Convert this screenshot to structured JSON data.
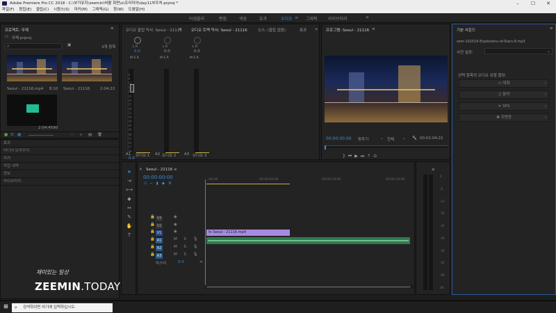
{
  "window": {
    "title": "Adobe Premiere Pro CC 2018 - C:\\부가유지\\zeemin\\비활 화면\\x\\프리미어\\day11부우처.prproj *"
  },
  "menu": [
    "파일(F)",
    "편집(E)",
    "클립(C)",
    "시퀀스(S)",
    "마커(M)",
    "그래픽(G)",
    "창(W)",
    "도움말(H)"
  ],
  "workspaces": {
    "items": [
      "어셈블리",
      "편집",
      "색상",
      "효과",
      "오디오",
      "그래픽",
      "라이브러리"
    ],
    "active": 4,
    "overflow": "»"
  },
  "project": {
    "title": "프로젝트: 무제",
    "subtitle": "무제.prproj",
    "count": "3개 항목",
    "items": [
      {
        "name": "Seoul - 21116.mp4",
        "duration": "8:10"
      },
      {
        "name": "Seoul - 21116",
        "duration": "2:04:22"
      },
      {
        "name": "",
        "duration": "2:04:4590"
      }
    ]
  },
  "left_panels": [
    "효과",
    "미디어 브라우저",
    "마커",
    "작업 내역",
    "정보",
    "라이브러리"
  ],
  "mixer": {
    "tabs": [
      "오디오 클립 믹서: Seoul - 21116",
      "오디오 트랙 믹서: Seoul - 21116",
      "소스: (클립 없음)",
      "효과"
    ],
    "channels": [
      {
        "id": "A1",
        "label": "오디오 1",
        "lr": "L  R",
        "val": "0.0"
      },
      {
        "id": "A2",
        "label": "오디오 2",
        "lr": "L  R",
        "val": "0.0"
      },
      {
        "id": "A3",
        "label": "오디오 3",
        "lr": "L  R",
        "val": "0.0"
      }
    ],
    "scale": [
      "-6",
      "-9",
      "-12",
      "-15",
      "-18",
      "-21",
      "-24",
      "-27",
      "-30",
      "-33",
      "-36",
      "-39",
      "-42",
      "-45",
      "-48",
      "-51",
      "-54",
      "-57",
      "-dB"
    ]
  },
  "program": {
    "title": "프로그램: Seoul - 21116",
    "timecode": "00:00:00:00",
    "fit": "맞추기",
    "quality": "전체",
    "duration": "00:02:04:22"
  },
  "sound": {
    "title": "기본 사운드",
    "file": "sem-102516-Explosions-of-Stars-8.mp3",
    "preset_label": "사전 설정:",
    "prompt": "선택 항목의 오디오 유형 할당:",
    "types": [
      "대화",
      "음악",
      "SFX",
      "주변광"
    ]
  },
  "timeline": {
    "tab": "Seoul - 21116",
    "timecode": "00:00:00:00",
    "ruler": [
      ":00:00",
      "00:00:05:00",
      "00:00:10:00",
      "00:00:15:00"
    ],
    "tracks": [
      {
        "id": "V3",
        "type": "video"
      },
      {
        "id": "V2",
        "type": "video"
      },
      {
        "id": "V1",
        "type": "video"
      },
      {
        "id": "A1",
        "type": "audio"
      },
      {
        "id": "A2",
        "type": "audio"
      },
      {
        "id": "A3",
        "type": "audio"
      }
    ],
    "master": {
      "label": "마스터",
      "value": "0.0"
    },
    "clip": "Seoul - 21116.mp4"
  },
  "right_meter": [
    "0",
    "-6",
    "-12",
    "-18",
    "-24",
    "-30",
    "-36",
    "-42",
    "-48",
    "dB"
  ],
  "watermark": {
    "top": "재미있는 일상",
    "main": "ZEEMIN",
    "suffix": ".TODAY"
  },
  "taskbar": {
    "search": "검색하려면 여기에 입력하십시오."
  },
  "colors": {
    "accent": "#3a8cd8",
    "clip": "#a78ae0",
    "audio": "#2f7a4f"
  }
}
